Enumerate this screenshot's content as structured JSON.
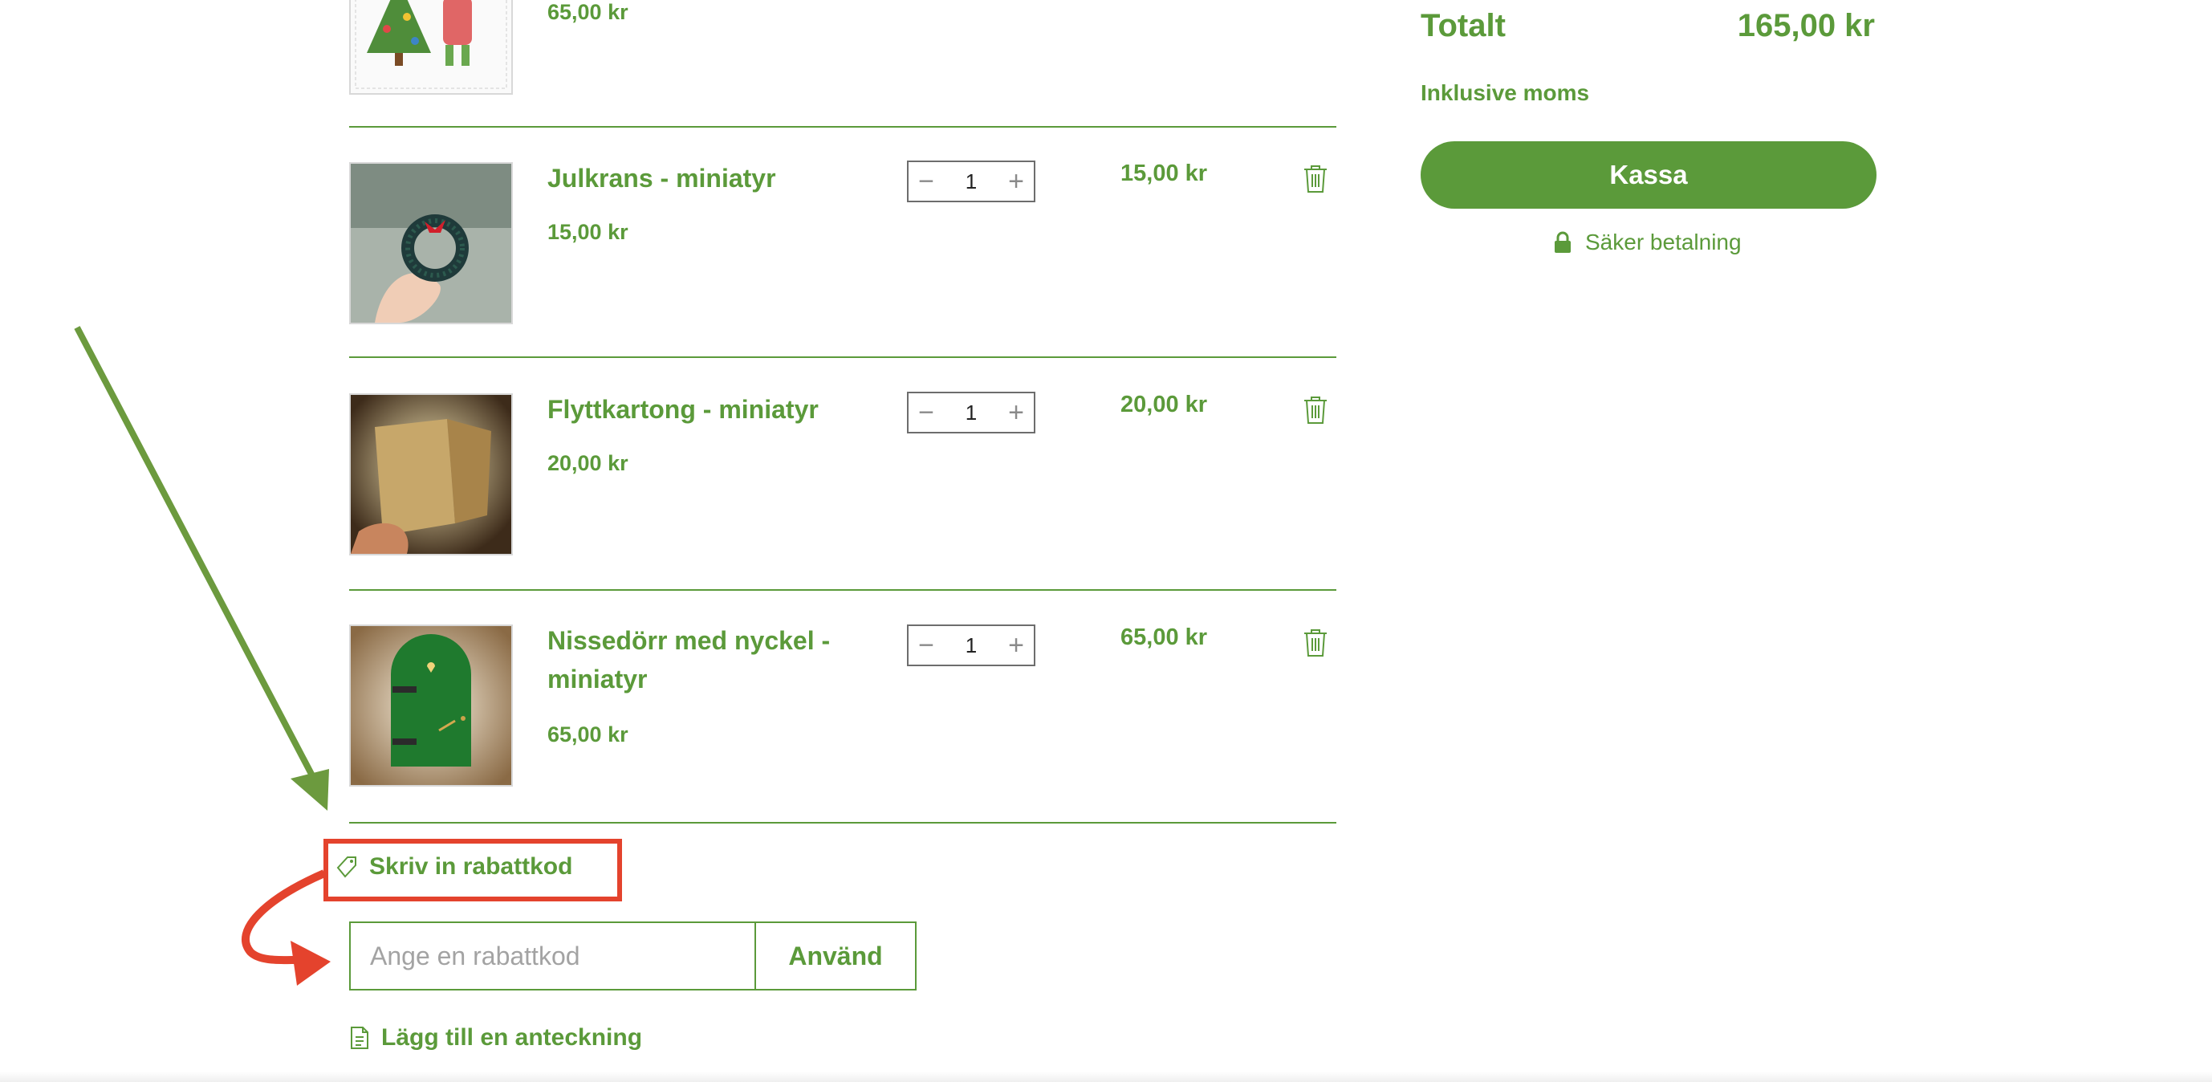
{
  "colors": {
    "accent": "#5b9a3a",
    "annotation_red": "#e4432d",
    "annotation_green": "#6c9a3e"
  },
  "cart": {
    "items": [
      {
        "name": "",
        "unit_price": "65,00 kr",
        "image": "christmas-card-image"
      },
      {
        "name": "Julkrans - miniatyr",
        "unit_price": "15,00 kr",
        "qty": "1",
        "line_total": "15,00 kr",
        "image": "wreath-image"
      },
      {
        "name": "Flyttkartong - miniatyr",
        "unit_price": "20,00 kr",
        "qty": "1",
        "line_total": "20,00 kr",
        "image": "moving-box-image"
      },
      {
        "name": "Nissedörr med nyckel - miniatyr",
        "unit_price": "65,00 kr",
        "qty": "1",
        "line_total": "65,00 kr",
        "image": "green-door-image"
      }
    ],
    "coupon": {
      "link_label": "Skriv in rabattkod",
      "placeholder": "Ange en rabattkod",
      "apply_label": "Använd"
    },
    "note": {
      "link_label": "Lägg till en anteckning"
    }
  },
  "summary": {
    "total_label": "Totalt",
    "total_value": "165,00 kr",
    "tax_note": "Inklusive moms",
    "checkout_label": "Kassa",
    "secure_label": "Säker betalning"
  },
  "icons": [
    "minus-icon",
    "plus-icon",
    "trash-icon",
    "tag-icon",
    "note-icon",
    "lock-icon"
  ]
}
